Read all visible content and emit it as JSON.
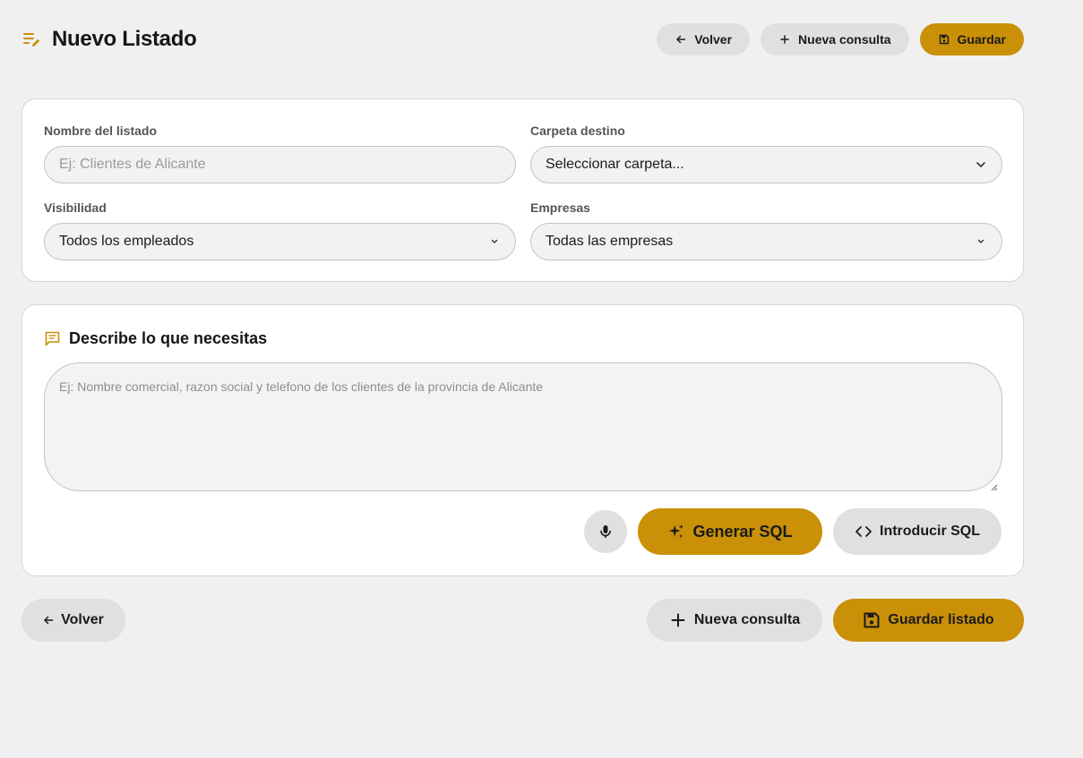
{
  "header": {
    "title": "Nuevo Listado",
    "back_label": "Volver",
    "new_query_label": "Nueva consulta",
    "save_label": "Guardar"
  },
  "form": {
    "name": {
      "label": "Nombre del listado",
      "placeholder": "Ej: Clientes de Alicante",
      "value": ""
    },
    "folder": {
      "label": "Carpeta destino",
      "selected": "Seleccionar carpeta..."
    },
    "visibility": {
      "label": "Visibilidad",
      "selected": "Todos los empleados"
    },
    "companies": {
      "label": "Empresas",
      "selected": "Todas las empresas"
    }
  },
  "describe": {
    "title": "Describe lo que necesitas",
    "placeholder": "Ej: Nombre comercial, razon social y telefono de los clientes de la provincia de Alicante",
    "value": "",
    "generate_label": "Generar SQL",
    "enter_sql_label": "Introducir SQL"
  },
  "footer": {
    "back_label": "Volver",
    "new_query_label": "Nueva consulta",
    "save_list_label": "Guardar listado"
  },
  "icons": {
    "title": "edit-list-icon",
    "back": "arrow-left-icon",
    "add": "plus-icon",
    "save": "floppy-disk-icon",
    "chevron": "chevron-down-icon",
    "describe": "chat-bubble-icon",
    "mic": "microphone-icon",
    "generate": "sparkles-icon",
    "code": "code-brackets-icon"
  },
  "colors": {
    "accent": "#c99008",
    "background": "#f0f0f0",
    "button_grey": "#e0e0e0",
    "card": "#ffffff"
  }
}
